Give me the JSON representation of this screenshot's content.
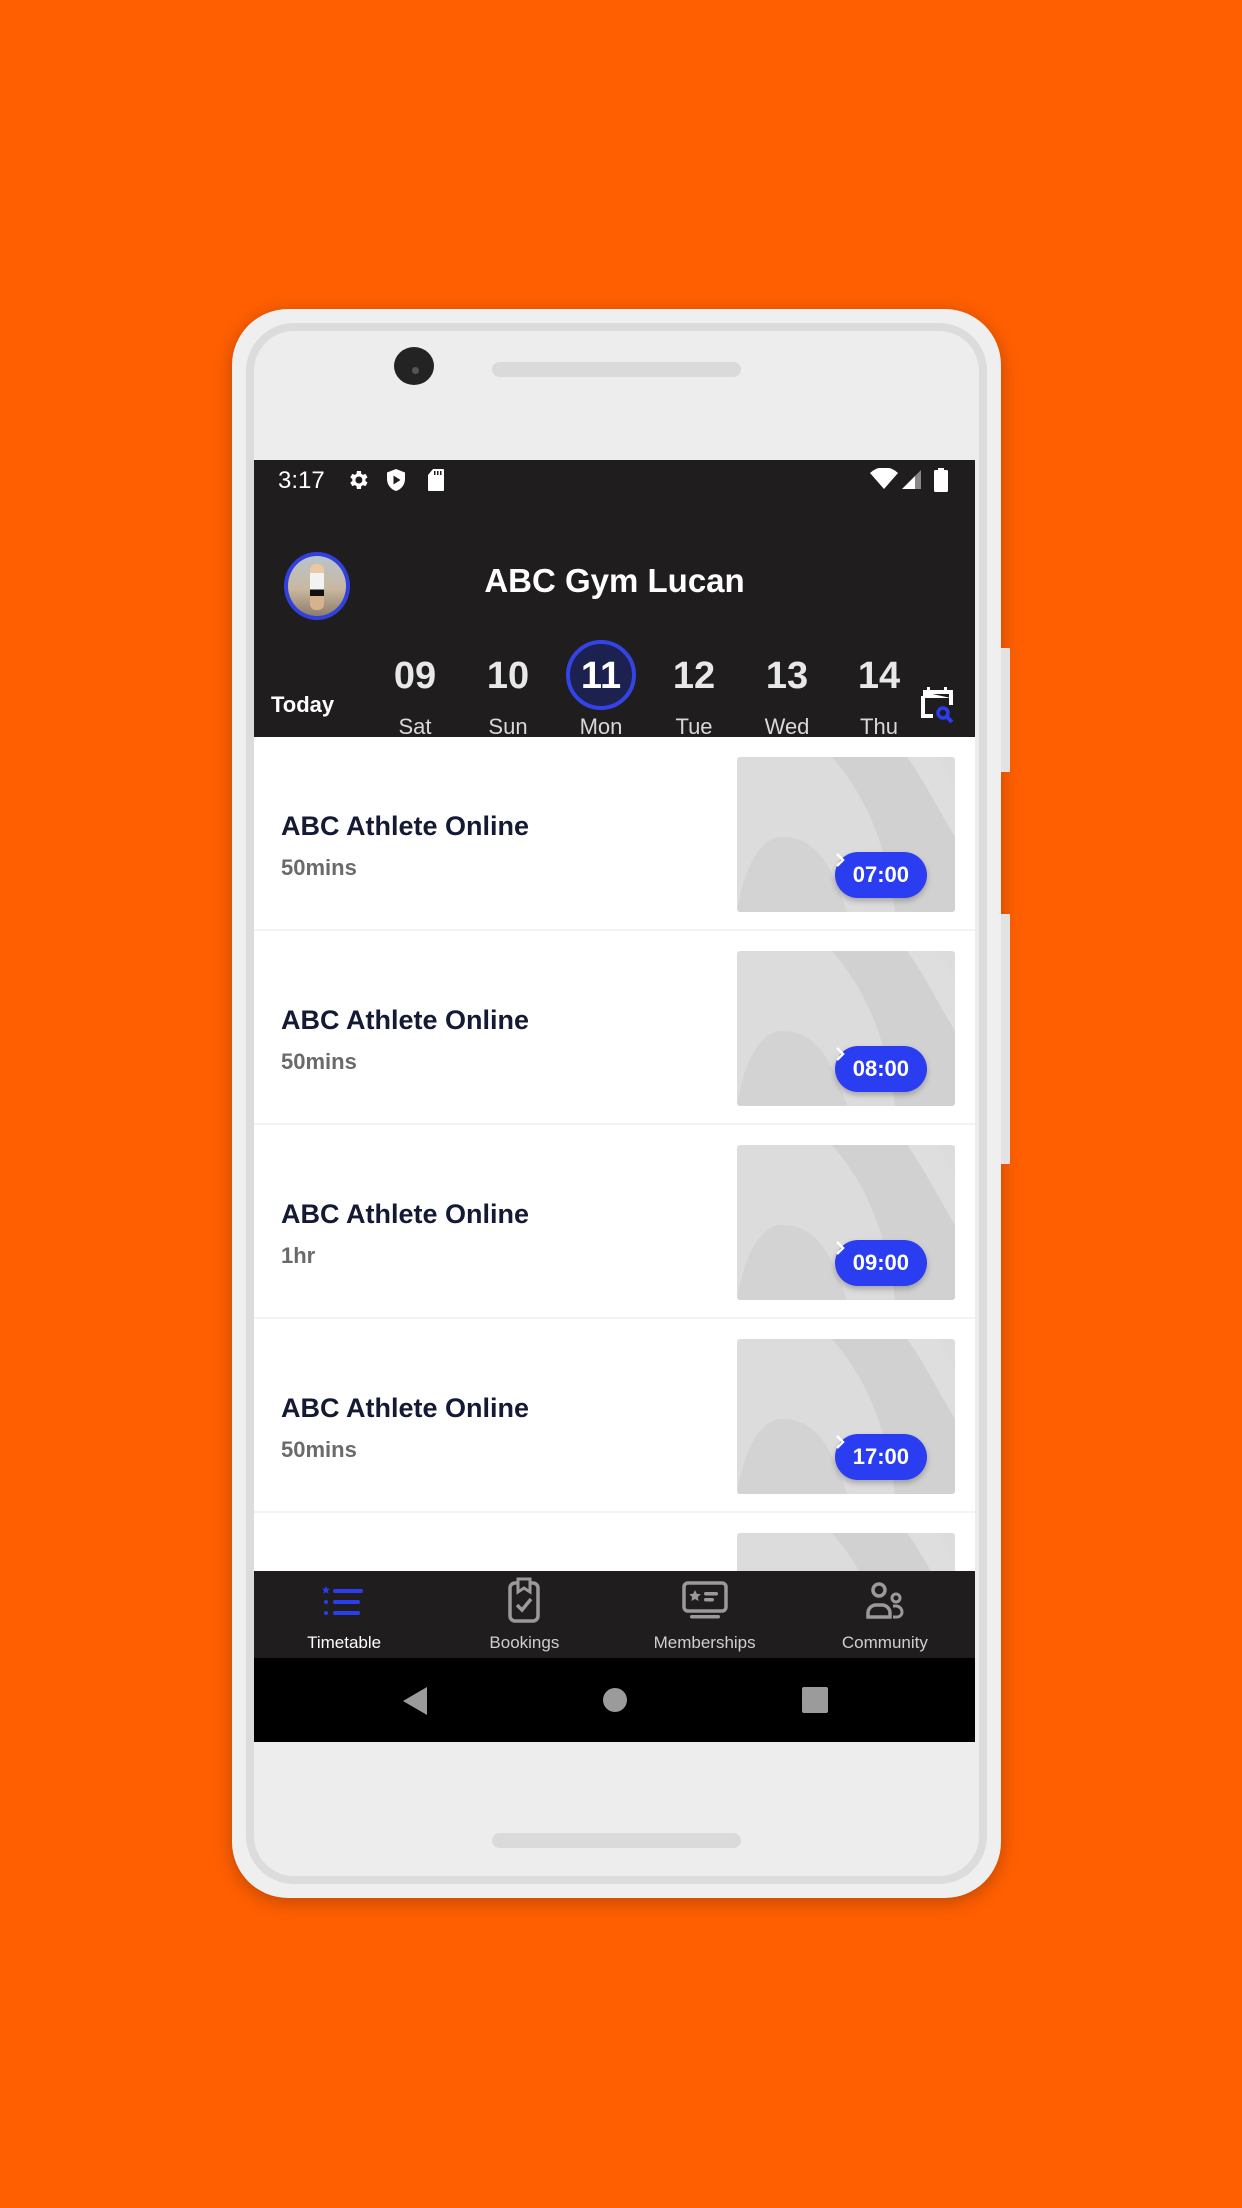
{
  "status_bar": {
    "time": "3:17",
    "left_icons": [
      "gear-icon",
      "shield-play-icon",
      "sd-card-icon"
    ],
    "right_icons": [
      "wifi-icon",
      "signal-icon",
      "battery-icon"
    ]
  },
  "header": {
    "title": "ABC Gym Lucan",
    "today_label": "Today",
    "days": [
      {
        "num": "09",
        "weekday": "Sat",
        "selected": false
      },
      {
        "num": "10",
        "weekday": "Sun",
        "selected": false
      },
      {
        "num": "11",
        "weekday": "Mon",
        "selected": true
      },
      {
        "num": "12",
        "weekday": "Tue",
        "selected": false
      },
      {
        "num": "13",
        "weekday": "Wed",
        "selected": false
      },
      {
        "num": "14",
        "weekday": "Thu",
        "selected": false
      }
    ]
  },
  "classes": [
    {
      "name": "ABC Athlete Online",
      "duration": "50mins",
      "time": "07:00"
    },
    {
      "name": "ABC Athlete Online",
      "duration": "50mins",
      "time": "08:00"
    },
    {
      "name": "ABC Athlete Online",
      "duration": "1hr",
      "time": "09:00"
    },
    {
      "name": "ABC Athlete Online",
      "duration": "50mins",
      "time": "17:00"
    }
  ],
  "bottom_nav": [
    {
      "label": "Timetable",
      "icon": "timetable-icon",
      "active": true
    },
    {
      "label": "Bookings",
      "icon": "clipboard-check-icon",
      "active": false
    },
    {
      "label": "Memberships",
      "icon": "membership-card-icon",
      "active": false
    },
    {
      "label": "Community",
      "icon": "people-icon",
      "active": false
    }
  ],
  "colors": {
    "background": "#ff5f00",
    "accent": "#2b3df0",
    "header_bg": "#1f1d1e"
  }
}
